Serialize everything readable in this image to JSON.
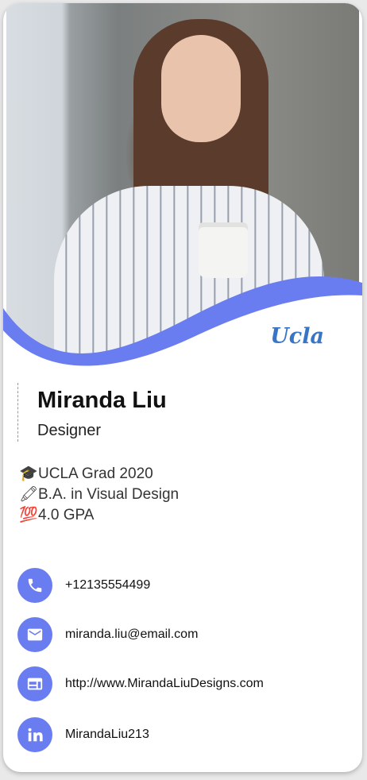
{
  "profile": {
    "name": "Miranda Liu",
    "title": "Designer",
    "school_logo": "Ucla"
  },
  "facts": [
    {
      "icon": "graduation-cap-icon",
      "emoji": "🎓",
      "text": "UCLA Grad 2020"
    },
    {
      "icon": "crayon-icon",
      "emoji": "🖍",
      "text": "B.A. in Visual Design"
    },
    {
      "icon": "hundred-points-icon",
      "emoji": "💯",
      "text": "4.0 GPA"
    }
  ],
  "contacts": {
    "phone": {
      "icon": "phone-icon",
      "text": "+12135554499"
    },
    "email": {
      "icon": "mail-icon",
      "text": "miranda.liu@email.com"
    },
    "website": {
      "icon": "web-card-icon",
      "text": "http://www.MirandaLiuDesigns.com"
    },
    "linkedin": {
      "icon": "linkedin-icon",
      "text": "MirandaLiu213"
    }
  },
  "colors": {
    "accent": "#6a7df0",
    "logo": "#3876c5"
  }
}
